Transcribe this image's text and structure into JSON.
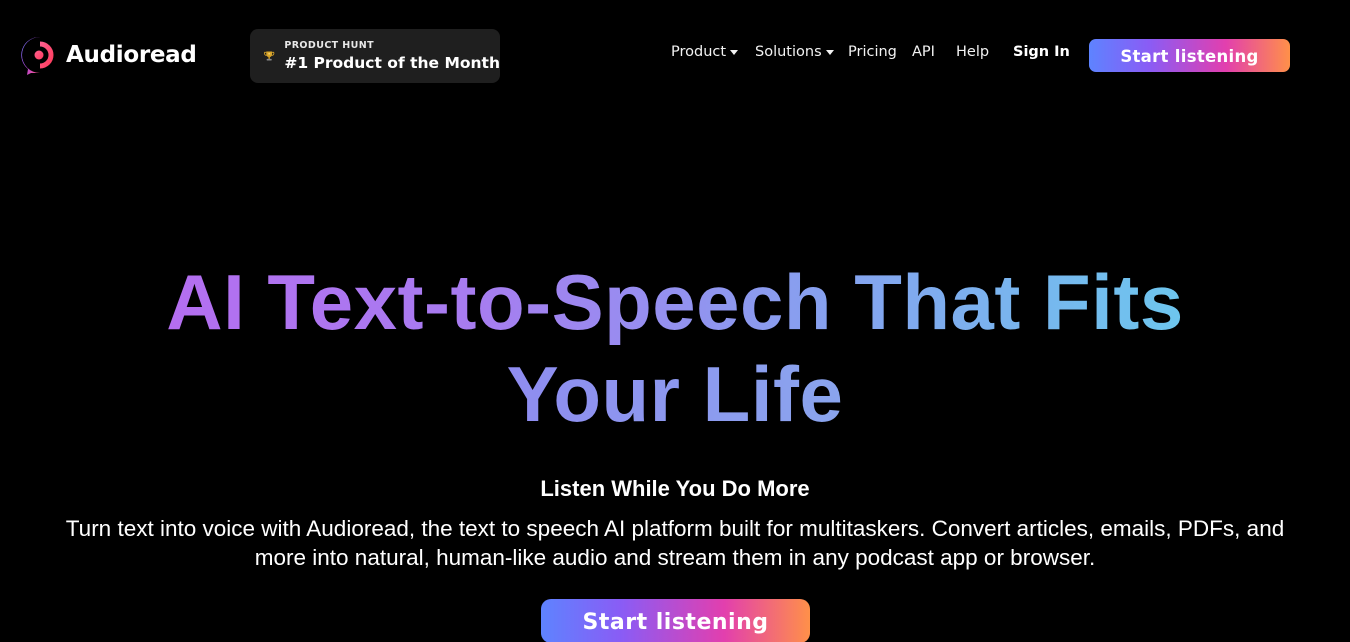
{
  "brand": {
    "name": "Audioread",
    "logo_icon": "audioread-logo-icon"
  },
  "badge": {
    "kicker": "PRODUCT HUNT",
    "title": "#1 Product of the Month",
    "icon": "trophy-icon"
  },
  "nav": {
    "items": [
      {
        "label": "Product",
        "has_dropdown": true
      },
      {
        "label": "Solutions",
        "has_dropdown": true
      },
      {
        "label": "Pricing",
        "has_dropdown": false
      },
      {
        "label": "API",
        "has_dropdown": false
      },
      {
        "label": "Help",
        "has_dropdown": false
      }
    ],
    "sign_in": "Sign In",
    "cta": "Start listening"
  },
  "hero": {
    "title_line1": "AI Text-to-Speech That Fits",
    "title_line2": "Your Life",
    "subheading": "Listen While You Do More",
    "description": "Turn text into voice with Audioread, the text to speech AI platform built for multitaskers. Convert articles, emails, PDFs, and more into natural, human-like audio and stream them in any podcast app or browser.",
    "cta": "Start listening"
  },
  "colors": {
    "background": "#000000",
    "cta_gradient": [
      "#5e83ff",
      "#8a5cf5",
      "#e23fae",
      "#ff9049"
    ],
    "title_gradient": [
      "#b46ef0",
      "#6dc6ee"
    ],
    "badge_background": "#1f1f1f"
  }
}
